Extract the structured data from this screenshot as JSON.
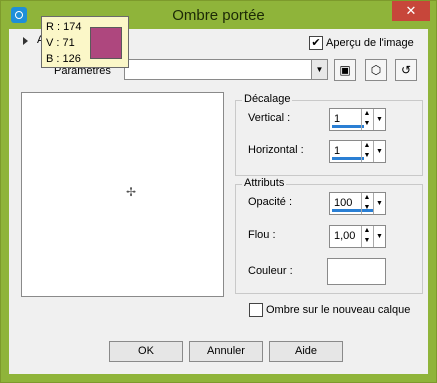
{
  "window": {
    "title": "Ombre portée",
    "close_label": "✕"
  },
  "tooltip": {
    "r": "R : 174",
    "v": "V : 71",
    "b": "B : 126",
    "swatch_color": "#ae477e"
  },
  "top": {
    "behind_label": "A",
    "preview_label": "Aperçu de l'image",
    "preview_checked": "✔",
    "params_label": "Paramètres"
  },
  "offset": {
    "title": "Décalage",
    "vertical_label": "Vertical :",
    "vertical_value": "1",
    "horizontal_label": "Horizontal :",
    "horizontal_value": "1"
  },
  "attributes": {
    "title": "Attributs",
    "opacity_label": "Opacité :",
    "opacity_value": "100",
    "blur_label": "Flou :",
    "blur_value": "1,00",
    "color_label": "Couleur :"
  },
  "shadow_layer_label": "Ombre sur le nouveau calque",
  "buttons": {
    "ok": "OK",
    "cancel": "Annuler",
    "help": "Aide"
  },
  "colors": {
    "titlebar": "#8fb43a",
    "close": "#c7463a",
    "accent": "#2a7fd4"
  }
}
